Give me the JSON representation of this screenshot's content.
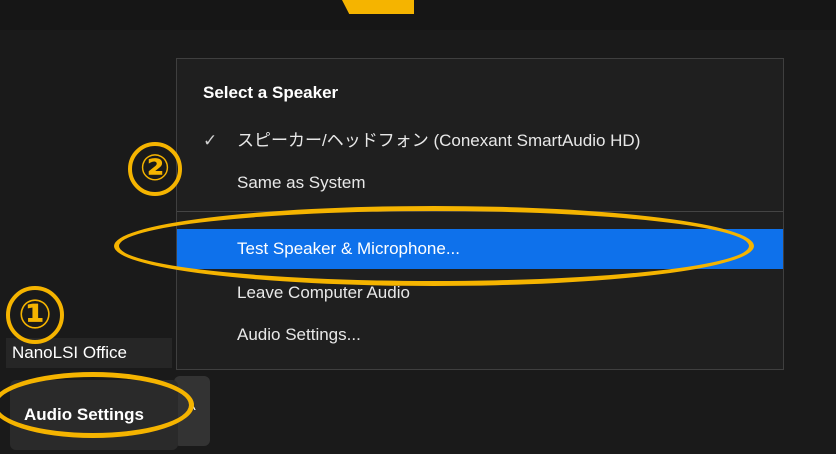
{
  "menu": {
    "title": "Select a Speaker",
    "items": [
      {
        "label": "スピーカー/ヘッドフォン (Conexant SmartAudio HD)",
        "checked": true
      },
      {
        "label": "Same as System",
        "checked": false
      },
      {
        "label": "Test Speaker & Microphone...",
        "checked": false,
        "highlighted": true
      },
      {
        "label": "Leave Computer Audio",
        "checked": false
      },
      {
        "label": "Audio Settings...",
        "checked": false
      }
    ],
    "check_glyph": "✓"
  },
  "annotations": {
    "step1": "①",
    "step2": "②"
  },
  "participant_name": "NanoLSI Office",
  "audio_button": {
    "label": "Audio Settings",
    "chevron": "^"
  },
  "colors": {
    "highlight": "#0e71eb",
    "annotation": "#f5b400",
    "background": "#1a1a1a"
  }
}
